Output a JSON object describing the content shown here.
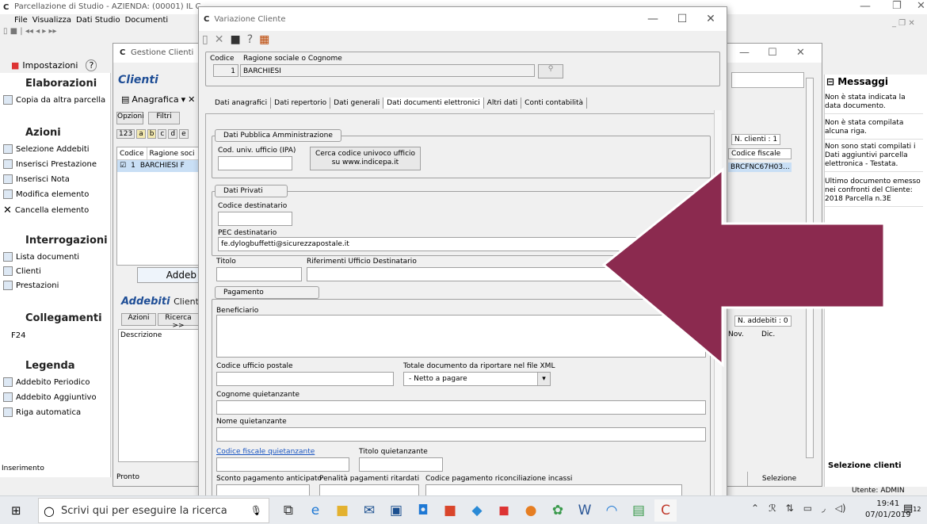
{
  "main_window": {
    "title": "Parcellazione di Studio - AZIENDA: (00001) IL C",
    "menu": [
      "File",
      "Visualizza",
      "Dati Studio",
      "Documenti"
    ]
  },
  "left_panel": {
    "tab_label": "Impostazioni",
    "status": "Inserimento",
    "sections": [
      {
        "title": "Elaborazioni",
        "items": [
          "Copia da altra parcella"
        ]
      },
      {
        "title": "Azioni",
        "items": [
          "Selezione Addebiti",
          "Inserisci Prestazione",
          "Inserisci Nota",
          "Modifica elemento",
          "Cancella elemento"
        ]
      },
      {
        "title": "Interrogazioni",
        "items": [
          "Lista documenti",
          "Clienti",
          "Prestazioni"
        ]
      },
      {
        "title": "Collegamenti",
        "items": [
          "F24"
        ]
      },
      {
        "title": "Legenda",
        "items": [
          "Addebito Periodico",
          "Addebito Aggiuntivo",
          "Riga automatica"
        ]
      }
    ]
  },
  "gestione": {
    "title": "Gestione Clienti",
    "heading": "Clienti",
    "anagrafica": "Anagrafica",
    "opzioni": "Opzioni",
    "filtri": "Filtri",
    "letters": [
      "123",
      "a",
      "b",
      "c",
      "d",
      "e"
    ],
    "col_codice": "Codice",
    "col_ragione": "Ragione soci",
    "row_code": "1",
    "row_name": "BARCHIESI F",
    "addebiti_btn": "Addeb",
    "addebiti_title": "Addebiti",
    "addebiti_client": "Client",
    "azioni": "Azioni",
    "ricerca": "Ricerca >>",
    "descrizione": "Descrizione",
    "status": "Pronto",
    "n_clienti": "N. clienti : 1",
    "codice_fiscale_col": "Codice fiscale",
    "codice_fiscale_val": "BRCFNC67H03...",
    "n_addebiti": "N. addebiti : 0",
    "col_nov": "Nov.",
    "col_dic": "Dic.",
    "selezione": "Selezione"
  },
  "messages": {
    "title": "Messaggi",
    "items": [
      "Non è stata indicata la data documento.",
      "Non è stata compilata alcuna riga.",
      "Non sono stati compilati i Dati aggiuntivi parcella elettronica - Testata.",
      "Ultimo documento emesso nei confronti del Cliente: 2018 Parcella n.3E"
    ],
    "footer": "Selezione clienti",
    "user": "Utente: ADMIN"
  },
  "dialog": {
    "title": "Variazione Cliente",
    "codice_label": "Codice",
    "ragione_label": "Ragione sociale o Cognome",
    "codice_value": "1",
    "ragione_value": "BARCHIESI",
    "tabs": [
      "Dati anagrafici",
      "Dati repertorio",
      "Dati generali",
      "Dati documenti elettronici",
      "Altri dati",
      "Conti contabilità"
    ],
    "active_tab": 3,
    "pa": {
      "title": "Dati Pubblica Amministrazione",
      "ipa_label": "Cod. univ. ufficio (IPA)",
      "ipa_value": "",
      "search_btn_line1": "Cerca codice univoco ufficio",
      "search_btn_line2": "su www.indicepa.it"
    },
    "privati": {
      "title": "Dati Privati",
      "codice_dest_label": "Codice destinatario",
      "codice_dest_value": "",
      "pec_label": "PEC destinatario",
      "pec_value": "fe.dylogbuffetti@sicurezzapostale.it"
    },
    "titolo_label": "Titolo",
    "rif_label": "Riferimenti Ufficio Destinatario",
    "pagamento": {
      "title": "Pagamento",
      "beneficiario_label": "Beneficiario",
      "cod_ufficio_postale_label": "Codice ufficio postale",
      "totale_label": "Totale documento da riportare nel file XML",
      "totale_value": "- Netto a pagare",
      "cognome_label": "Cognome quietanzante",
      "nome_label": "Nome quietanzante",
      "cf_label": "Codice fiscale quietanzante",
      "titolo_q_label": "Titolo quietanzante",
      "sconto_label": "Sconto pagamento anticipato",
      "penalita_label": "Penalità pagamenti ritardati",
      "codice_pag_label": "Codice pagamento riconciliazione incassi"
    }
  },
  "arrow": {
    "color": "#8b2a4f"
  },
  "taskbar": {
    "search_placeholder": "Scrivi qui per eseguire la ricerca",
    "time": "19:41",
    "date": "07/01/2019",
    "notification_count": "12",
    "apps": [
      "task-view",
      "edge",
      "file-explorer",
      "mail",
      "store",
      "outlook",
      "office",
      "onenote-like",
      "paint",
      "chrome",
      "settings",
      "word",
      "wifi-app",
      "photos",
      "parcellazione"
    ]
  }
}
